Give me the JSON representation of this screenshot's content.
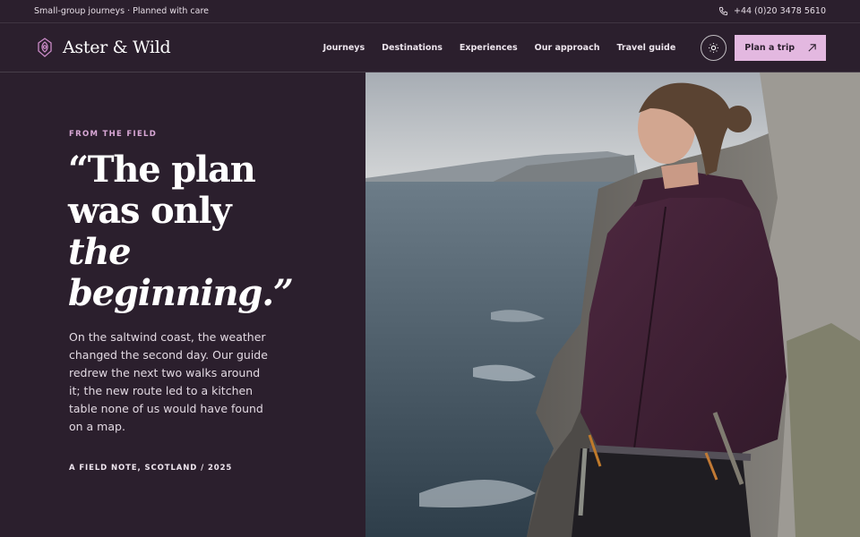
{
  "topbar": {
    "tagline": "Small-group journeys · Planned with care",
    "phone": "+44 (0)20 3478 5610",
    "phone_icon": "phone-icon"
  },
  "header": {
    "brand": "Aster & Wild",
    "logo_icon": "rose-icon",
    "nav": [
      "Journeys",
      "Destinations",
      "Experiences",
      "Our approach",
      "Travel guide"
    ],
    "theme_icon": "sun-icon",
    "cta_label": "Plan a trip",
    "cta_icon": "arrow-up-right-icon"
  },
  "hero": {
    "eyebrow": "FROM THE FIELD",
    "quote_line1": "“The plan",
    "quote_line2": "was only",
    "quote_line3": "the",
    "quote_line4": "beginning.”",
    "body": "On the saltwind coast, the weather changed the second day. Our guide redrew the next two walks around it; the new route led to a kitchen table none of us would have found on a map.",
    "attribution": "A FIELD NOTE, SCOTLAND / 2025"
  },
  "colors": {
    "background": "#2b1f2d",
    "accent": "#e3b8e0",
    "eyebrow": "#d9a8d6"
  }
}
